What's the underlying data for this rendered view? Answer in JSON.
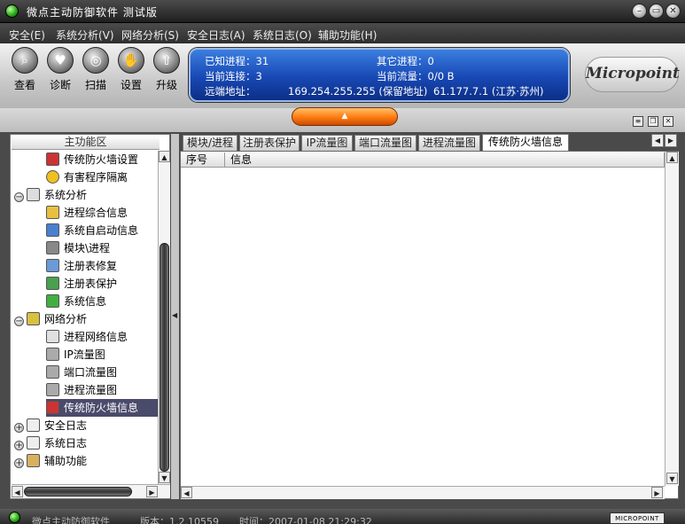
{
  "window": {
    "title": "微点主动防御软件  测试版"
  },
  "menu": [
    "安全(E)",
    "系统分析(V)",
    "网络分析(S)",
    "安全日志(A)",
    "系统日志(O)",
    "辅助功能(H)"
  ],
  "toolbar": [
    {
      "label": "查看",
      "icon": "magnifier-icon"
    },
    {
      "label": "诊断",
      "icon": "heart-icon"
    },
    {
      "label": "扫描",
      "icon": "scan-icon"
    },
    {
      "label": "设置",
      "icon": "hand-icon"
    },
    {
      "label": "升级",
      "icon": "upgrade-icon"
    }
  ],
  "info": {
    "known_processes": "已知进程：31",
    "other_processes": "其它进程：0",
    "current_connections": "当前连接：3",
    "current_traffic": "当前流量：0/0 B",
    "remote_label": "远端地址：",
    "remote_local": "169.254.255.255 (保留地址)",
    "remote_addr": "61.177.7.1 (江苏·苏州)"
  },
  "logo": {
    "text": "Micropoint"
  },
  "sidebar": {
    "title": "主功能区",
    "items": [
      {
        "label": "传统防火墙设置",
        "level": 2,
        "icon": "firewall-icon"
      },
      {
        "label": "有害程序隔离",
        "level": 2,
        "icon": "biohazard-icon"
      },
      {
        "label": "系统分析",
        "level": 1,
        "expander": "−",
        "icon": "monitor-icon"
      },
      {
        "label": "进程综合信息",
        "level": 2,
        "icon": "process-icon"
      },
      {
        "label": "系统自启动信息",
        "level": 2,
        "icon": "startup-icon"
      },
      {
        "label": "模块\\进程",
        "level": 2,
        "icon": "module-icon"
      },
      {
        "label": "注册表修复",
        "level": 2,
        "icon": "registry-repair-icon"
      },
      {
        "label": "注册表保护",
        "level": 2,
        "icon": "registry-protect-icon"
      },
      {
        "label": "系统信息",
        "level": 2,
        "icon": "system-info-icon"
      },
      {
        "label": "网络分析",
        "level": 1,
        "expander": "−",
        "icon": "network-icon"
      },
      {
        "label": "进程网络信息",
        "level": 2,
        "icon": "process-network-icon"
      },
      {
        "label": "IP流量图",
        "level": 2,
        "icon": "ip-traffic-icon"
      },
      {
        "label": "端口流量图",
        "level": 2,
        "icon": "port-traffic-icon"
      },
      {
        "label": "进程流量图",
        "level": 2,
        "icon": "process-traffic-icon"
      },
      {
        "label": "传统防火墙信息",
        "level": 2,
        "icon": "firewall-info-icon",
        "selected": true
      },
      {
        "label": "安全日志",
        "level": 1,
        "expander": "+",
        "icon": "log-icon"
      },
      {
        "label": "系统日志",
        "level": 1,
        "expander": "+",
        "icon": "syslog-icon"
      },
      {
        "label": "辅助功能",
        "level": 1,
        "expander": "+",
        "icon": "tools-icon"
      }
    ]
  },
  "tabs": [
    {
      "label": "模块/进程"
    },
    {
      "label": "注册表保护"
    },
    {
      "label": "IP流量图"
    },
    {
      "label": "端口流量图"
    },
    {
      "label": "进程流量图"
    },
    {
      "label": "传统防火墙信息",
      "active": true
    }
  ],
  "table": {
    "columns": [
      "序号",
      "信息"
    ]
  },
  "status": {
    "app": "微点主动防御软件",
    "version": "版本：1.2.10559",
    "time": "时间：2007-01-08 21:29:32",
    "badge": "MICROPOINT"
  },
  "colors": {
    "accent": "#ff7a10",
    "panel": "#1848b4",
    "selected": "#4a4a6a"
  }
}
